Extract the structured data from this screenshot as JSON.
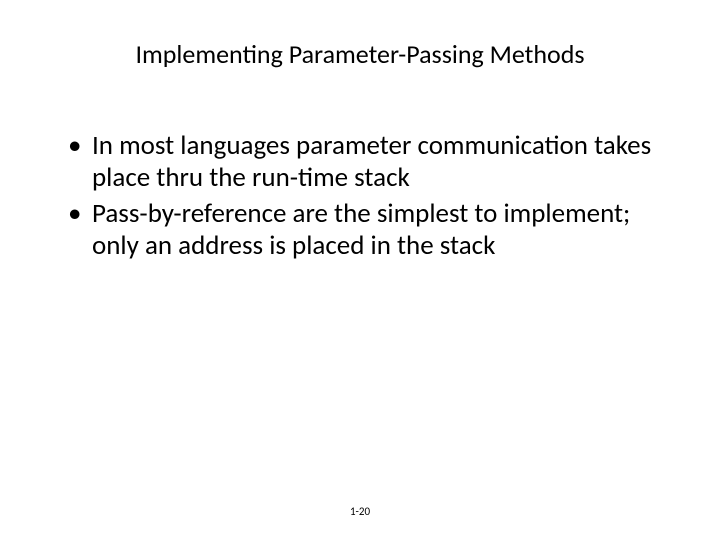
{
  "title": "Implementing Parameter-Passing Methods",
  "bullets": [
    "In most languages parameter communication takes place thru the run-time stack",
    "Pass-by-reference are the simplest to implement; only an address is placed in the stack"
  ],
  "page_number": "1-20"
}
